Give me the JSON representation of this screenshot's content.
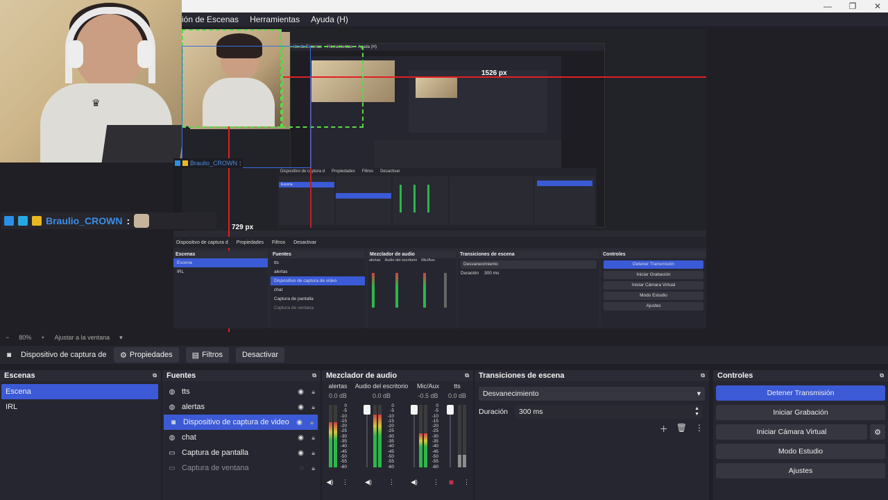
{
  "menubar": {
    "items": [
      "ión de Escenas",
      "Herramientas",
      "Ayuda (H)"
    ]
  },
  "window_controls": {
    "minimize": "—",
    "maximize": "❐",
    "close": "✕"
  },
  "preview": {
    "width_label": "1526 px",
    "height_label": "729 px",
    "chat_name": "Braulio_CROWN",
    "chat_colon": ":",
    "nested_menu": [
      "ión de Escenas",
      "Herramientas",
      "Ayuda (H)"
    ],
    "nested_toolbar": [
      "Dispositivo de captura d",
      "Propiedades",
      "Filtros",
      "Desactivar"
    ],
    "nested_docks": {
      "scenes_title": "Escenas",
      "scenes": [
        "Escena",
        "IRL"
      ],
      "sources_title": "Fuentes",
      "sources": [
        "tts",
        "alertas",
        "Dispositivo de captura de video",
        "chat",
        "Captura de pantalla",
        "Captura de ventana"
      ],
      "mixer_title": "Mezclador de audio",
      "mixer_labels": [
        "alertas",
        "Audio del escritorio",
        "Mic/Aux"
      ],
      "trans_title": "Transiciones de escena",
      "trans_value": "Desvanecimiento",
      "trans_dur_label": "Duración",
      "trans_dur": "300 ms",
      "controls_title": "Controles",
      "controls": [
        "Detener Transmisión",
        "Iniciar Grabación",
        "Iniciar Cámara Virtual",
        "Modo Estudio",
        "Ajustes"
      ]
    }
  },
  "zoombar": {
    "minus": "−",
    "zoom": "80%",
    "plus": "+",
    "fit": "Ajustar a la ventana",
    "arrow": "▾"
  },
  "source_toolbar": {
    "source_name": "Dispositivo de captura de v",
    "properties": "Propiedades",
    "filters": "Filtros",
    "deactivate": "Desactivar"
  },
  "scenes": {
    "title": "Escenas",
    "items": [
      "Escena",
      "IRL"
    ],
    "selected": "Escena"
  },
  "sources": {
    "title": "Fuentes",
    "items": [
      {
        "label": "tts",
        "icon": "globe-icon",
        "visible": true
      },
      {
        "label": "alertas",
        "icon": "globe-icon",
        "visible": true
      },
      {
        "label": "Dispositivo de captura de video",
        "icon": "camera-icon",
        "visible": true,
        "selected": true
      },
      {
        "label": "chat",
        "icon": "globe-icon",
        "visible": true
      },
      {
        "label": "Captura de pantalla",
        "icon": "monitor-icon",
        "visible": true
      },
      {
        "label": "Captura de ventana",
        "icon": "window-icon",
        "visible": false
      }
    ]
  },
  "mixer": {
    "title": "Mezclador de audio",
    "channels": [
      {
        "name": "alertas",
        "db": "0.0 dB",
        "level": 0.72
      },
      {
        "name": "Audio del escritorio",
        "db": "0.0 dB",
        "level": 0.85
      },
      {
        "name": "Mic/Aux",
        "db": "-0.5 dB",
        "level": 0.55
      },
      {
        "name": "tts",
        "db": "0.0 dB",
        "level": 0.2
      }
    ],
    "scale": [
      "0",
      "-5",
      "-10",
      "-15",
      "-20",
      "-25",
      "-30",
      "-35",
      "-40",
      "-45",
      "-50",
      "-55",
      "-60"
    ]
  },
  "transitions": {
    "title": "Transiciones de escena",
    "selected": "Desvanecimiento",
    "duration_label": "Duración",
    "duration": "300 ms"
  },
  "controls": {
    "title": "Controles",
    "stop_stream": "Detener Transmisión",
    "start_recording": "Iniciar Grabación",
    "start_virtual_cam": "Iniciar Cámara Virtual",
    "studio_mode": "Modo Estudio",
    "settings": "Ajustes"
  },
  "colors": {
    "accent": "#3c5ad6",
    "panel": "#262630",
    "guide_red": "#e02020",
    "guide_green": "#5ed84a",
    "chat_name": "#3d8ee8"
  }
}
